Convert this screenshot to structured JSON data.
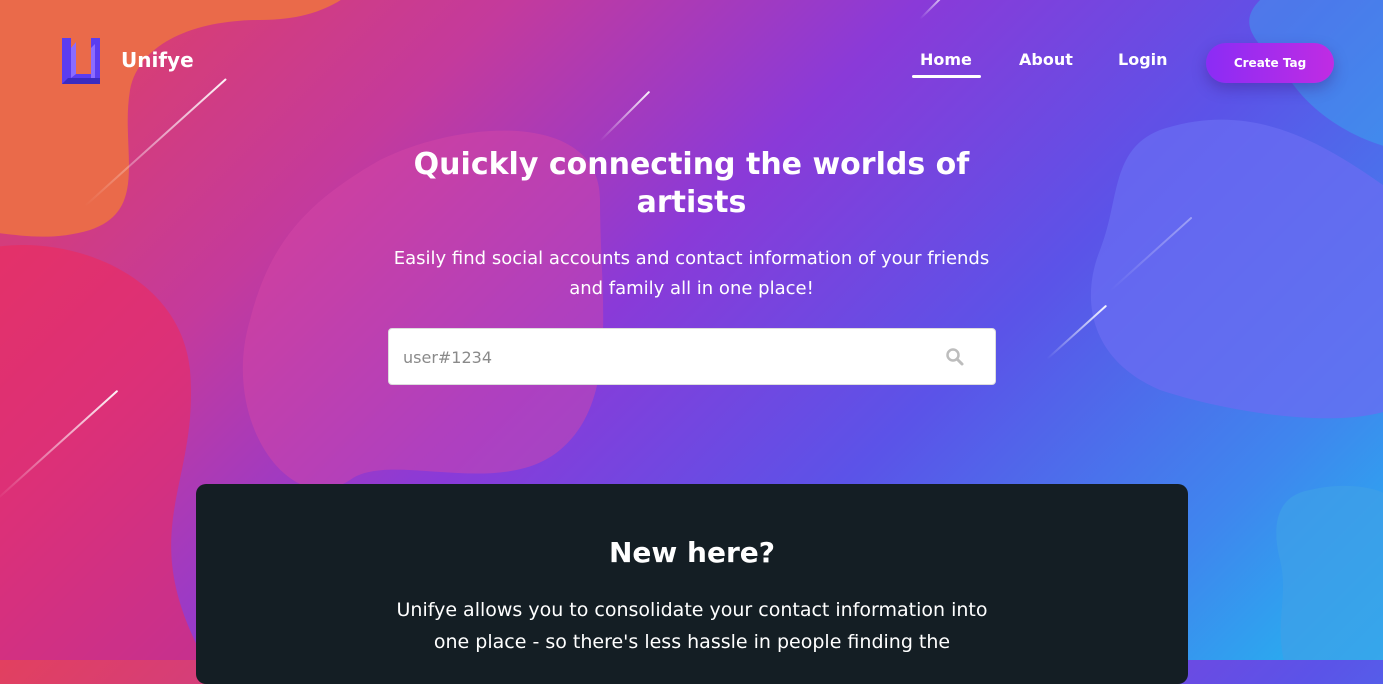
{
  "brand": {
    "name": "Unifye",
    "logo_icon": "unifye-logo-icon"
  },
  "nav": {
    "links": [
      {
        "label": "Home",
        "active": true
      },
      {
        "label": "About",
        "active": false
      },
      {
        "label": "Login",
        "active": false
      }
    ],
    "cta_label": "Create Tag"
  },
  "hero": {
    "title": "Quickly connecting the worlds of artists",
    "subtitle": "Easily find social accounts and contact information of your friends and family all in one place!",
    "search": {
      "placeholder": "user#1234",
      "value": "",
      "icon": "search-icon"
    }
  },
  "panel": {
    "title": "New here?",
    "text": "Unifye allows you to consolidate your contact information into one place - so there's less hassle in people finding the"
  },
  "colors": {
    "cta_gradient_start": "#8b2cf5",
    "cta_gradient_end": "#c02ce3",
    "panel_bg": "#141e24",
    "logo_purple": "#5b3df0"
  }
}
